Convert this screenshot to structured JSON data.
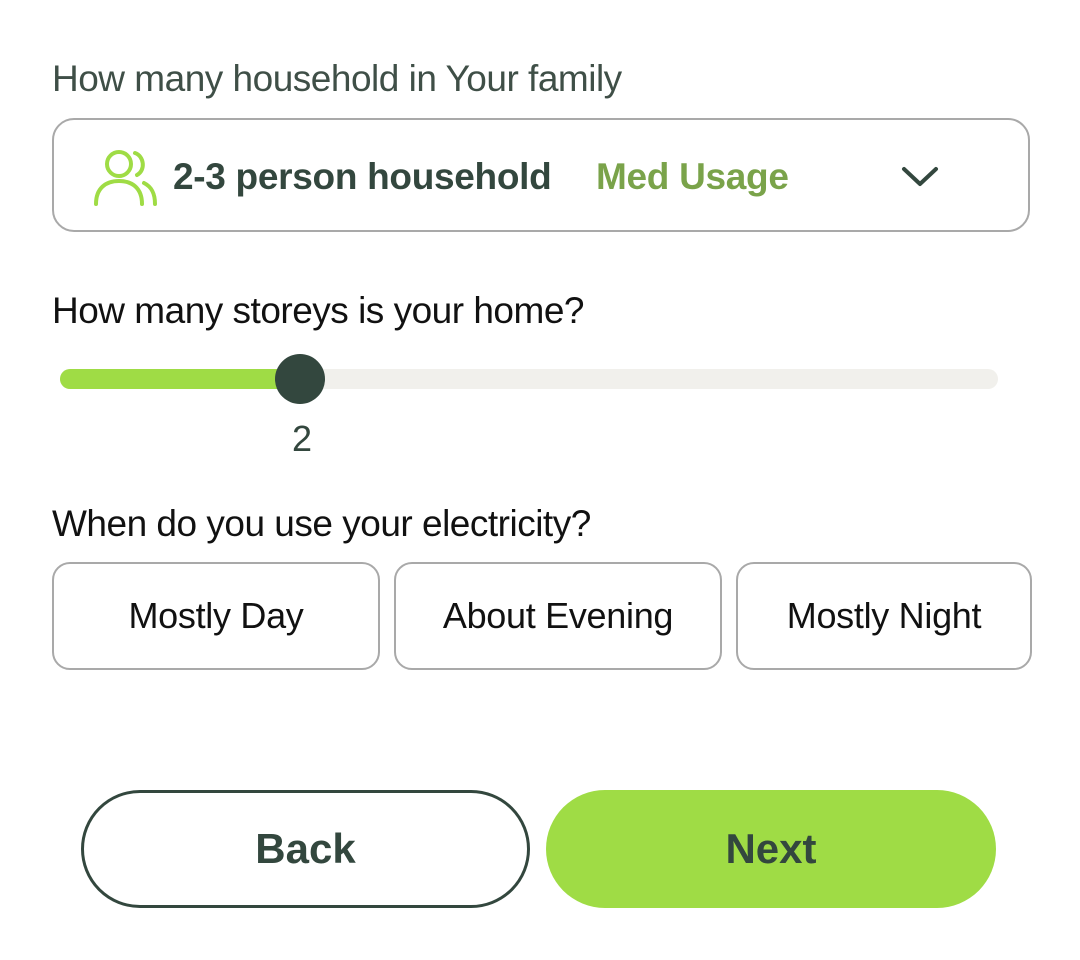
{
  "colors": {
    "dark_green": "#33473e",
    "accent_green": "#9fdc45",
    "sub_label_green": "#7aa34a",
    "border_gray": "#a9a9a9",
    "track_gray": "#f1f0ec"
  },
  "household": {
    "label": "How many household in Your family",
    "icon": "people-icon",
    "selected": "2-3 person household",
    "usage": "Med Usage",
    "chevron_icon": "chevron-down-icon"
  },
  "storeys": {
    "label": "How many storeys is your home?",
    "value": "2"
  },
  "electricity": {
    "label": "When do you use your electricity?",
    "options": [
      "Mostly Day",
      "About Evening",
      "Mostly Night"
    ]
  },
  "nav": {
    "back": "Back",
    "next": "Next"
  }
}
